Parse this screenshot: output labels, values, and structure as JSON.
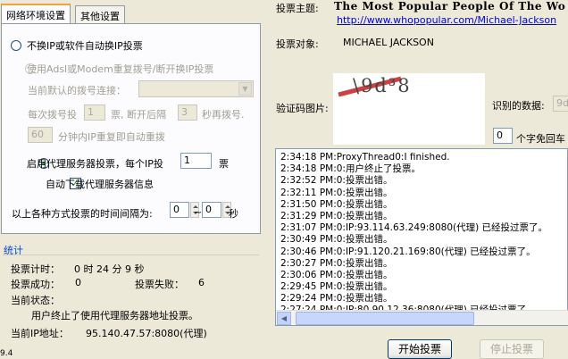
{
  "tabs": [
    {
      "label": "网络环境设置",
      "active": true
    },
    {
      "label": "其他设置",
      "active": false
    }
  ],
  "network": {
    "opt_no_ip_change": "不换IP或软件自动换IP投票",
    "opt_adsl_modem": "使用Adsl或Modem重复拨号/断开换IP投票",
    "dial_conn_label": "当前默认的拨号连接：",
    "dial_conn_value": "",
    "per_dial_label": "每次拨号投",
    "per_dial_value": "1",
    "per_dial_unit": "票, 断开后隔",
    "redial_delay_value": "3",
    "redial_unit": "秒再拨号.",
    "redial_within_value": "60",
    "redial_within_text": "分钟内IP重复即自动重拨",
    "opt_proxy": "启用代理服务器投票，每个IP投",
    "proxy_votes_value": "1",
    "proxy_votes_unit": "票",
    "auto_download_proxy": "自动下载代理服务器信息",
    "auto_download_checked": true,
    "interval_label": "以上各种方式投票的时间间隔为:",
    "interval_min": "0",
    "interval_sep": "~",
    "interval_max": "0",
    "interval_unit": "秒"
  },
  "stats": {
    "title": "统计",
    "timer_label": "投票计时：",
    "timer_value": "0 时 24 分 9 秒",
    "success_label": "投票成功：",
    "success_value": "0",
    "fail_label": "投票失败：",
    "fail_value": "6",
    "state_label": "当前状态：",
    "state_value": "用户终止了使用代理服务器地址投票。",
    "ip_label": "当前IP地址：",
    "ip_value": "95.140.47.57:8080(代理)"
  },
  "vote": {
    "subject_label": "投票主题:",
    "subject_value": "The Most Popular People Of The Wo",
    "url": "http://www.whopopular.com/Michael-Jackson",
    "object_label": "投票对象:",
    "object_value": "MICHAEL JACKSON",
    "captcha_label": "验证码图片:",
    "captcha_text": "\\9d³8",
    "recognized_label": "识别的数据:",
    "recognized_value": "9d",
    "skip_value": "0",
    "skip_label": "个字免回车"
  },
  "log": [
    "2:34:18 PM:ProxyThread0:I finished.",
    "2:34:18 PM:0:用户终止了投票。",
    "2:32:52 PM:0:投票出错。",
    "2:32:11 PM:0:投票出错。",
    "2:31:50 PM:0:投票出错。",
    "2:31:29 PM:0:投票出错。",
    "2:31:07 PM:0:IP:93.114.63.249:8080(代理) 已经投过票了。",
    "2:30:49 PM:0:投票出错。",
    "2:30:46 PM:0:IP:91.120.21.169:80(代理) 已经投过票了。",
    "2:30:27 PM:0:投票出错。",
    "2:30:06 PM:0:投票出错。",
    "2:29:45 PM:0:投票出错。",
    "2:29:24 PM:0:投票出错。",
    "2:27:24 PM:0:IP:80.90.12.36:8080(代理) 已经投过票了。"
  ],
  "buttons": {
    "start": "开始投票",
    "stop": "停止投票"
  },
  "version_fragment": "9.4"
}
